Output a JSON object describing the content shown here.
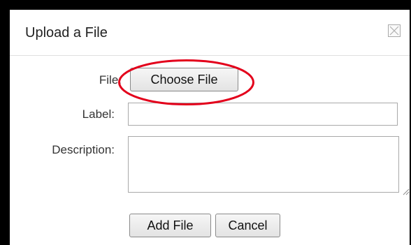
{
  "dialog": {
    "title": "Upload a File"
  },
  "form": {
    "file_label": "File:",
    "choose_file_label": "Choose File",
    "label_label": "Label:",
    "label_value": "",
    "description_label": "Description:",
    "description_value": ""
  },
  "actions": {
    "add_file_label": "Add File",
    "cancel_label": "Cancel"
  },
  "icons": {
    "close": "close-icon"
  },
  "colors": {
    "annotation": "#e3001b"
  }
}
